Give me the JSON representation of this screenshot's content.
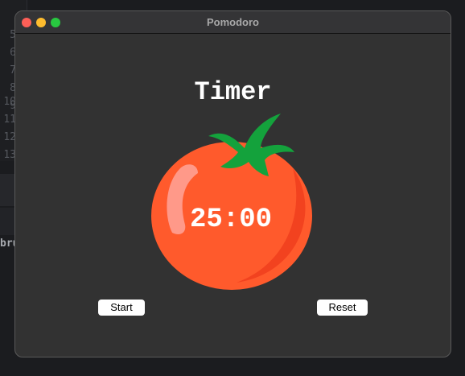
{
  "background_editor": {
    "line_numbers": [
      "5",
      "6",
      "7",
      "8",
      "9",
      "10",
      "11",
      "12",
      "13"
    ],
    "snippet": "bru"
  },
  "window": {
    "title": "Pomodoro",
    "traffic_lights": {
      "close": "#fe5f57",
      "minimize": "#febc2e",
      "zoom": "#28c840"
    },
    "heading": "Timer",
    "timer_display": "25:00",
    "image": "tomato",
    "buttons": {
      "start": "Start",
      "reset": "Reset"
    }
  }
}
